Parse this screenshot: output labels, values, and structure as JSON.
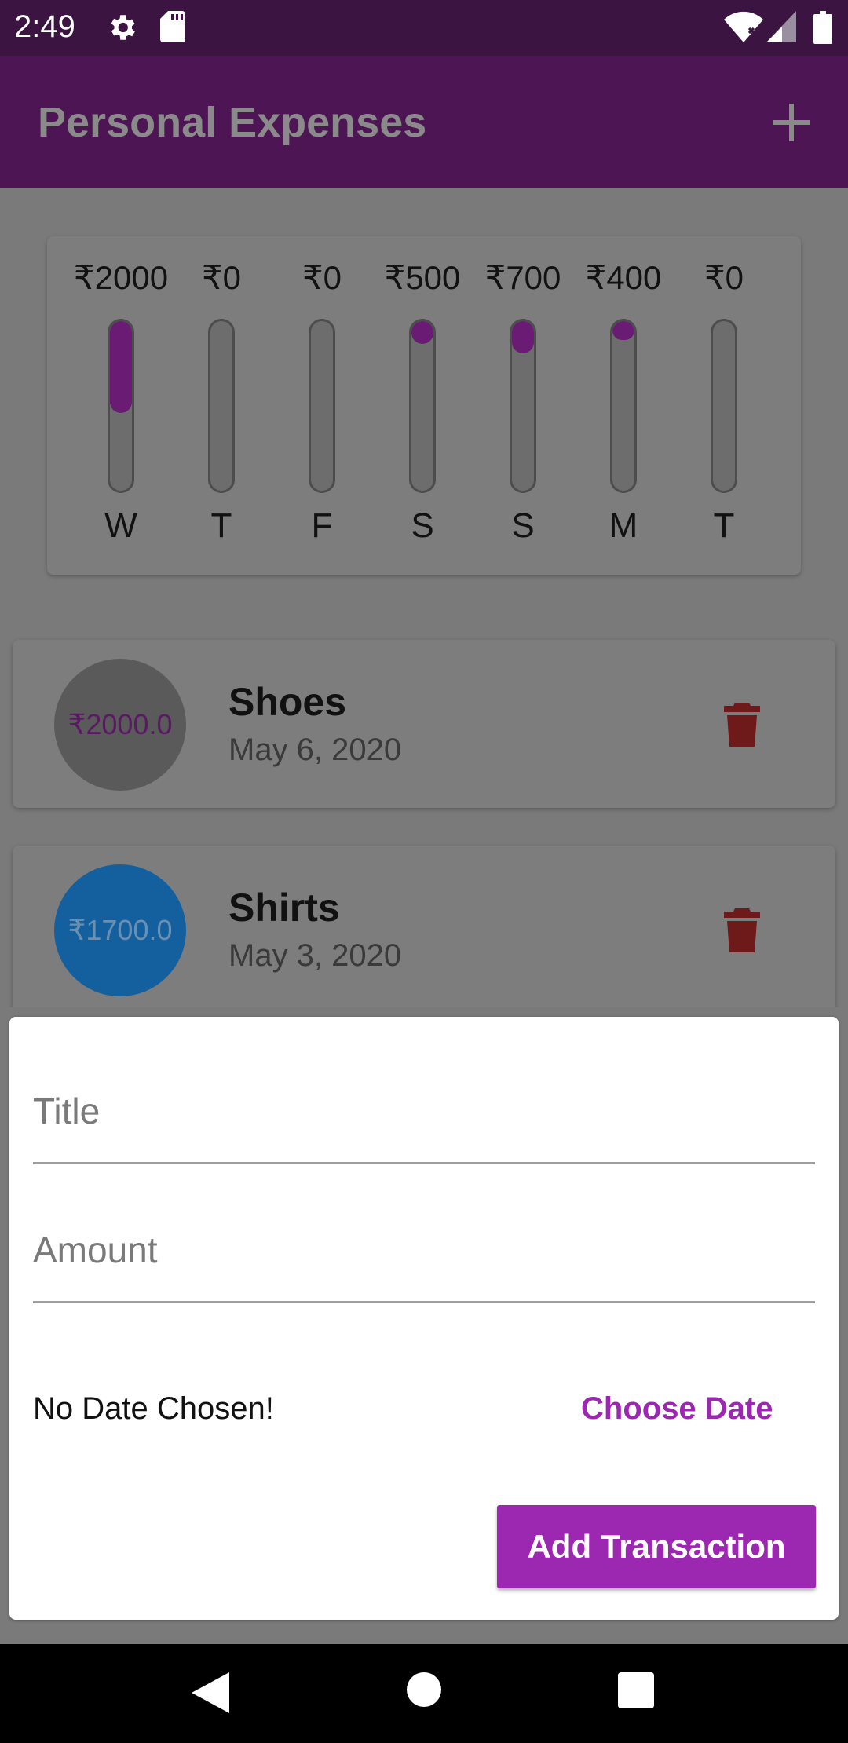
{
  "status_bar": {
    "time": "2:49",
    "icons": [
      "gear-icon",
      "sd-card-icon",
      "wifi-icon",
      "signal-icon",
      "battery-icon"
    ]
  },
  "app_bar": {
    "title": "Personal Expenses",
    "add_icon": "plus-icon"
  },
  "chart": {
    "bars": [
      {
        "amount": "₹2000",
        "day": "W",
        "fill": 0.54
      },
      {
        "amount": "₹0",
        "day": "T",
        "fill": 0
      },
      {
        "amount": "₹0",
        "day": "F",
        "fill": 0
      },
      {
        "amount": "₹500",
        "day": "S",
        "fill": 0.135
      },
      {
        "amount": "₹700",
        "day": "S",
        "fill": 0.19
      },
      {
        "amount": "₹400",
        "day": "M",
        "fill": 0.11
      },
      {
        "amount": "₹0",
        "day": "T",
        "fill": 0
      }
    ],
    "fill_color": "#6a1b74"
  },
  "transactions": [
    {
      "amount": "₹2000.0",
      "title": "Shoes",
      "date": "May 6, 2020",
      "avatar_color": "#5a5a5a",
      "amount_color": "#5a1a63"
    },
    {
      "amount": "₹1700.0",
      "title": "Shirts",
      "date": "May 3, 2020",
      "avatar_color": "#14609e",
      "amount_color": "#6b8fb0"
    }
  ],
  "form": {
    "title_placeholder": "Title",
    "amount_placeholder": "Amount",
    "no_date_text": "No Date Chosen!",
    "choose_date_label": "Choose Date",
    "submit_label": "Add Transaction",
    "accent_color": "#9c27b0"
  },
  "nav": [
    "back-icon",
    "home-icon",
    "recents-icon"
  ]
}
